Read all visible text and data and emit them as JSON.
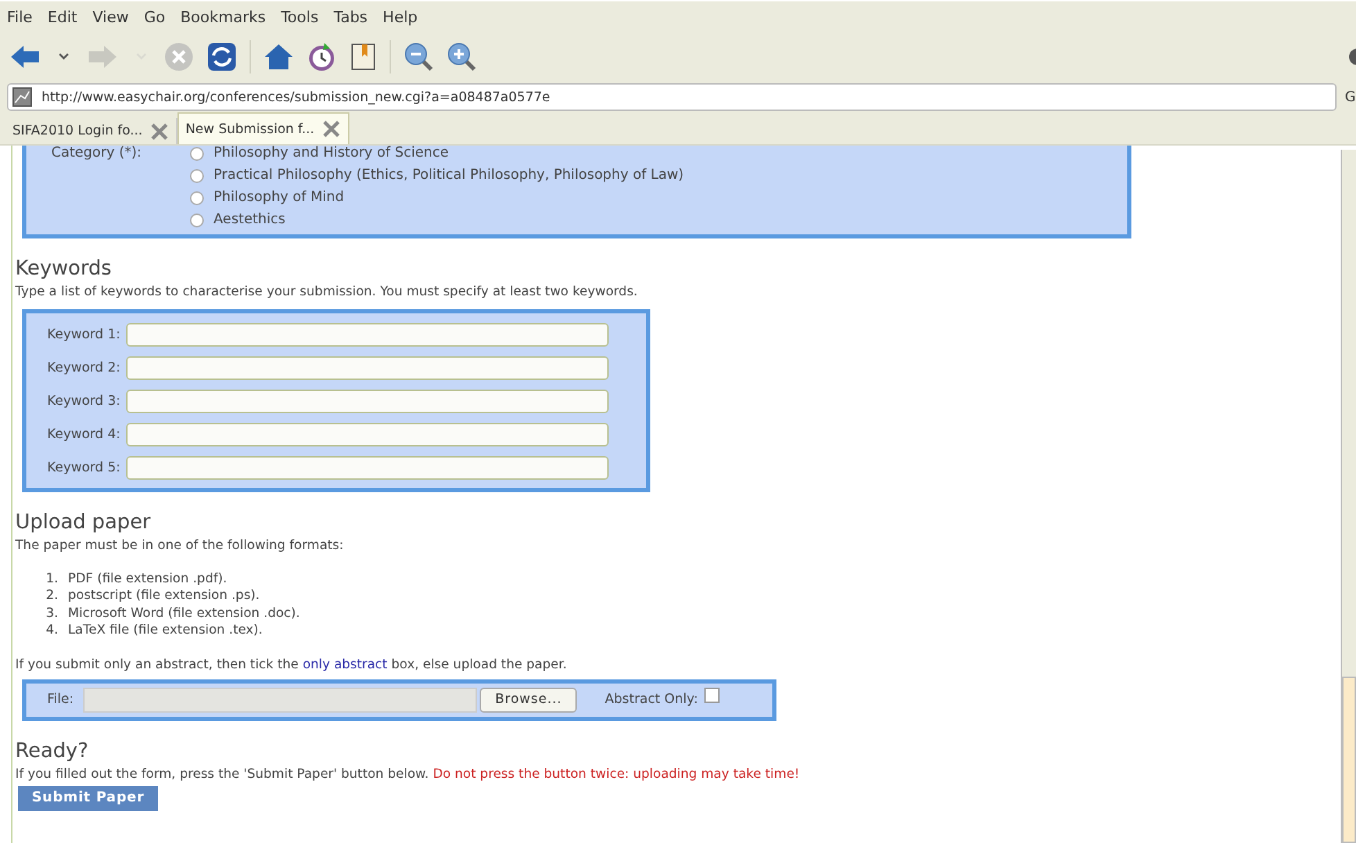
{
  "menu": [
    "File",
    "Edit",
    "View",
    "Go",
    "Bookmarks",
    "Tools",
    "Tabs",
    "Help"
  ],
  "toolbar": [
    {
      "kind": "back",
      "disabled": false
    },
    {
      "kind": "dropdown",
      "disabled": false
    },
    {
      "kind": "forward",
      "disabled": true
    },
    {
      "kind": "dropdown",
      "disabled": true
    },
    {
      "kind": "stop",
      "disabled": true
    },
    {
      "kind": "reload",
      "disabled": false
    },
    {
      "kind": "separator"
    },
    {
      "kind": "home",
      "disabled": false
    },
    {
      "kind": "history",
      "disabled": false
    },
    {
      "kind": "bookmarks",
      "disabled": false
    },
    {
      "kind": "separator"
    },
    {
      "kind": "zoom-out",
      "disabled": false
    },
    {
      "kind": "zoom-in",
      "disabled": false
    }
  ],
  "address": {
    "url": "http://www.easychair.org/conferences/submission_new.cgi?a=a08487a0577e",
    "go": "G"
  },
  "tabs": [
    {
      "label": "SIFA2010 Login fo...",
      "selected": false
    },
    {
      "label": "New Submission f...",
      "selected": true
    }
  ],
  "category": {
    "label": "Category (*):",
    "options": [
      {
        "label": "Philosophy and History of Science",
        "selected": false
      },
      {
        "label": "Practical Philosophy (Ethics, Political Philosophy, Philosophy of Law)",
        "selected": false
      },
      {
        "label": "Philosophy of Mind",
        "selected": false
      },
      {
        "label": "Aestethics",
        "selected": false
      }
    ]
  },
  "keywords": {
    "heading": "Keywords",
    "text": "Type a list of keywords to characterise your submission. You must specify at least two keywords.",
    "fields": [
      "Keyword 1:",
      "Keyword 2:",
      "Keyword 3:",
      "Keyword 4:",
      "Keyword 5:"
    ]
  },
  "upload": {
    "heading": "Upload paper",
    "text": "The paper must be in one of the following formats:",
    "formats": [
      {
        "number": "1.",
        "text": "PDF (file extension .pdf)."
      },
      {
        "number": "2.",
        "text": "postscript (file extension .ps)."
      },
      {
        "number": "3.",
        "text": "Microsoft Word (file extension .doc)."
      },
      {
        "number": "4.",
        "text": "LaTeX file (file extension .tex)."
      }
    ],
    "note_before": "If you submit only an abstract, then tick the",
    "note_link": "only abstract",
    "note_after": "box, else upload the paper.",
    "file_label": "File:",
    "browse": "Browse...",
    "abstract_label": "Abstract Only:",
    "abstract_checked": false
  },
  "ready": {
    "heading": "Ready?",
    "text": "If you filled out the form, press the 'Submit Paper' button below.",
    "warning": "Do not press the button twice: uploading may take time!",
    "submit": "Submit Paper"
  }
}
